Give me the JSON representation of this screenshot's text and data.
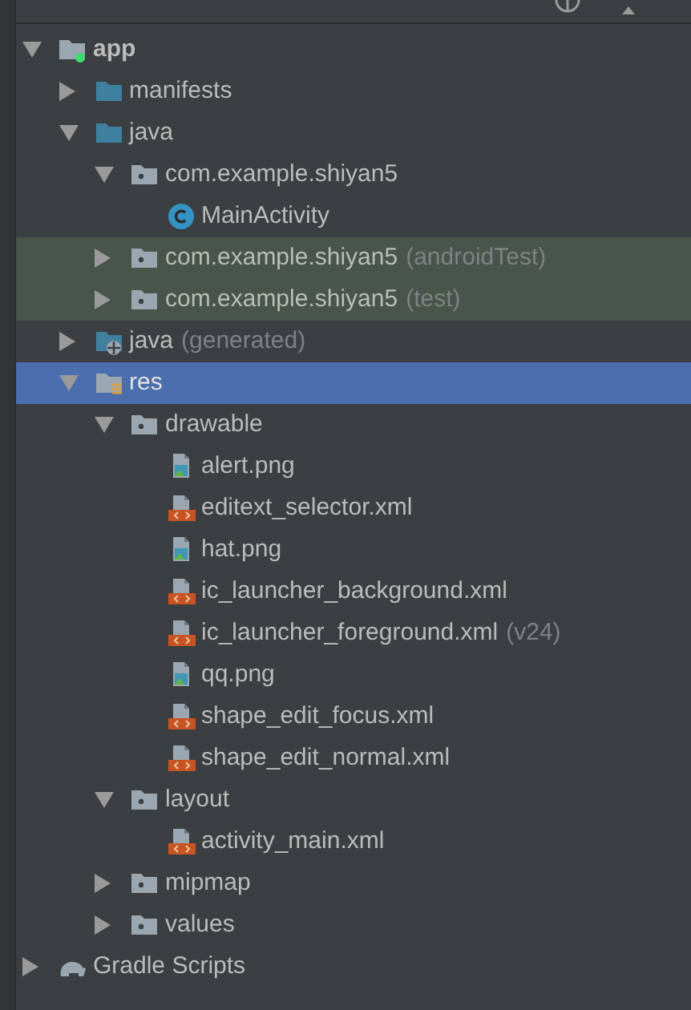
{
  "tree": [
    {
      "label": "app",
      "kind": "module",
      "expanded": true,
      "selected": false,
      "tinted": false,
      "children": [
        {
          "label": "manifests",
          "kind": "folder",
          "expanded": false,
          "selected": false,
          "tinted": false
        },
        {
          "label": "java",
          "kind": "folder",
          "expanded": true,
          "selected": false,
          "tinted": false,
          "children": [
            {
              "label": "com.example.shiyan5",
              "kind": "package",
              "expanded": true,
              "selected": false,
              "tinted": false,
              "children": [
                {
                  "label": "MainActivity",
                  "kind": "class",
                  "selected": false,
                  "tinted": false
                }
              ]
            },
            {
              "label": "com.example.shiyan5",
              "suffix": "(androidTest)",
              "kind": "package",
              "expanded": false,
              "selected": false,
              "tinted": true
            },
            {
              "label": "com.example.shiyan5",
              "suffix": "(test)",
              "kind": "package",
              "expanded": false,
              "selected": false,
              "tinted": true
            }
          ]
        },
        {
          "label": "java",
          "suffix": "(generated)",
          "kind": "generated_folder",
          "expanded": false,
          "selected": false,
          "tinted": false
        },
        {
          "label": "res",
          "kind": "resource_folder",
          "expanded": true,
          "selected": true,
          "tinted": false,
          "children": [
            {
              "label": "drawable",
              "kind": "package",
              "expanded": true,
              "selected": false,
              "tinted": false,
              "children": [
                {
                  "label": "alert.png",
                  "kind": "image",
                  "selected": false,
                  "tinted": false
                },
                {
                  "label": "editext_selector.xml",
                  "kind": "xml",
                  "selected": false,
                  "tinted": false
                },
                {
                  "label": "hat.png",
                  "kind": "image",
                  "selected": false,
                  "tinted": false
                },
                {
                  "label": "ic_launcher_background.xml",
                  "kind": "xml",
                  "selected": false,
                  "tinted": false
                },
                {
                  "label": "ic_launcher_foreground.xml",
                  "suffix": "(v24)",
                  "kind": "xml",
                  "selected": false,
                  "tinted": false
                },
                {
                  "label": "qq.png",
                  "kind": "image",
                  "selected": false,
                  "tinted": false
                },
                {
                  "label": "shape_edit_focus.xml",
                  "kind": "xml",
                  "selected": false,
                  "tinted": false
                },
                {
                  "label": "shape_edit_normal.xml",
                  "kind": "xml",
                  "selected": false,
                  "tinted": false
                }
              ]
            },
            {
              "label": "layout",
              "kind": "package",
              "expanded": true,
              "selected": false,
              "tinted": false,
              "children": [
                {
                  "label": "activity_main.xml",
                  "kind": "xml",
                  "selected": false,
                  "tinted": false
                }
              ]
            },
            {
              "label": "mipmap",
              "kind": "package",
              "expanded": false,
              "selected": false,
              "tinted": false
            },
            {
              "label": "values",
              "kind": "package",
              "expanded": false,
              "selected": false,
              "tinted": false
            }
          ]
        }
      ]
    },
    {
      "label": "Gradle Scripts",
      "kind": "gradle",
      "expanded": false,
      "selected": false,
      "tinted": false
    }
  ]
}
